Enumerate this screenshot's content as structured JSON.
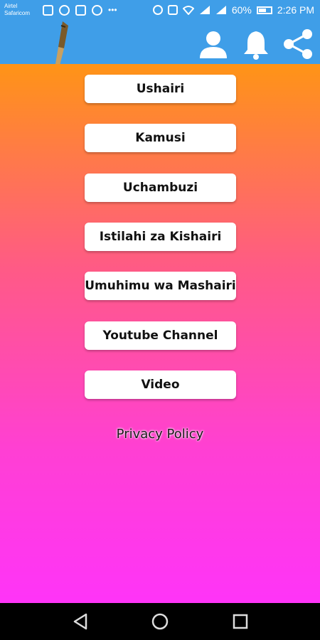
{
  "status_bar": {
    "carrier_line1": "Airtel",
    "carrier_line2": "Safaricom",
    "battery": "60%",
    "time": "2:26 PM"
  },
  "app_bar": {
    "logo_icon": "fountain-pen-icon",
    "icons": [
      "person-icon",
      "bell-icon",
      "share-icon"
    ]
  },
  "menu": {
    "items": [
      "Ushairi",
      "Kamusi",
      "Uchambuzi",
      "Istilahi za Kishairi",
      "Umuhimu wa Mashairi",
      "Youtube Channel",
      "Video"
    ],
    "privacy_link": "Privacy Policy"
  },
  "colors": {
    "app_bar": "#3f9ee8",
    "gradient_top": "#ff9416",
    "gradient_bottom": "#ff34f8"
  }
}
